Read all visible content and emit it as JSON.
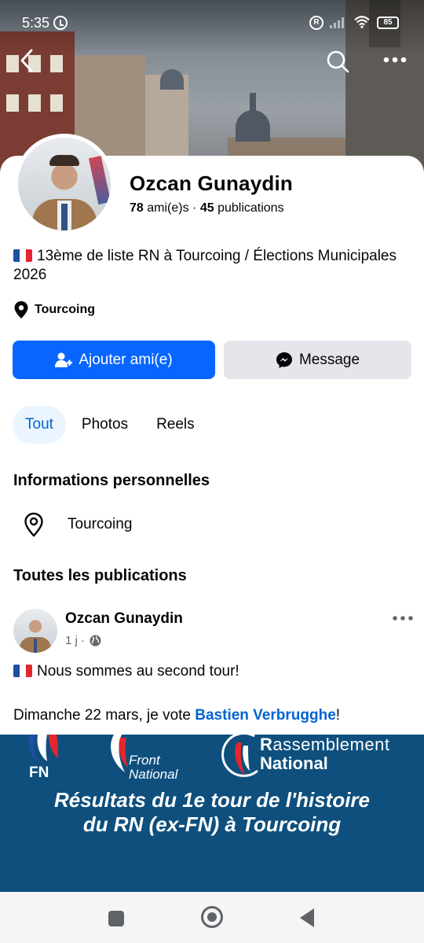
{
  "status_bar": {
    "time": "5:35",
    "r_label": "R",
    "battery": "85"
  },
  "profile": {
    "name": "Ozcan Gunaydin",
    "friends_count": "78",
    "friends_label": "ami(e)s",
    "separator": "·",
    "posts_count": "45",
    "posts_label": "publications",
    "bio": "13ème de liste RN à Tourcoing / Élections Municipales 2026",
    "location": "Tourcoing"
  },
  "actions": {
    "add_friend_label": "Ajouter ami(e)",
    "message_label": "Message"
  },
  "tabs": [
    {
      "label": "Tout",
      "active": true
    },
    {
      "label": "Photos",
      "active": false
    },
    {
      "label": "Reels",
      "active": false
    }
  ],
  "personal_info": {
    "title": "Informations personnelles",
    "location": "Tourcoing"
  },
  "posts_section": {
    "title": "Toutes les publications"
  },
  "post": {
    "author": "Ozcan Gunaydin",
    "time": "1 j",
    "meta_sep": "·",
    "line1": "Nous sommes au second tour!",
    "line2_prefix": "Dimanche 22 mars, je vote ",
    "line2_link": "Bastien Verbrugghe",
    "line2_suffix": "!",
    "image": {
      "fn_label": "FN",
      "front_line1": "Front",
      "front_line2": "National",
      "rn_line1_cap": "R",
      "rn_line1_rest": "assemblement",
      "rn_line2": "National",
      "headline_line1": "Résultats du 1e tour de l'histoire",
      "headline_line2": "du RN (ex-FN) à Tourcoing"
    }
  },
  "colors": {
    "primary": "#0866ff",
    "tab_active_bg": "#ebf5ff",
    "tab_active_text": "#0064d1",
    "secondary_btn": "#e4e6eb",
    "post_banner": "#0e4f7d"
  }
}
